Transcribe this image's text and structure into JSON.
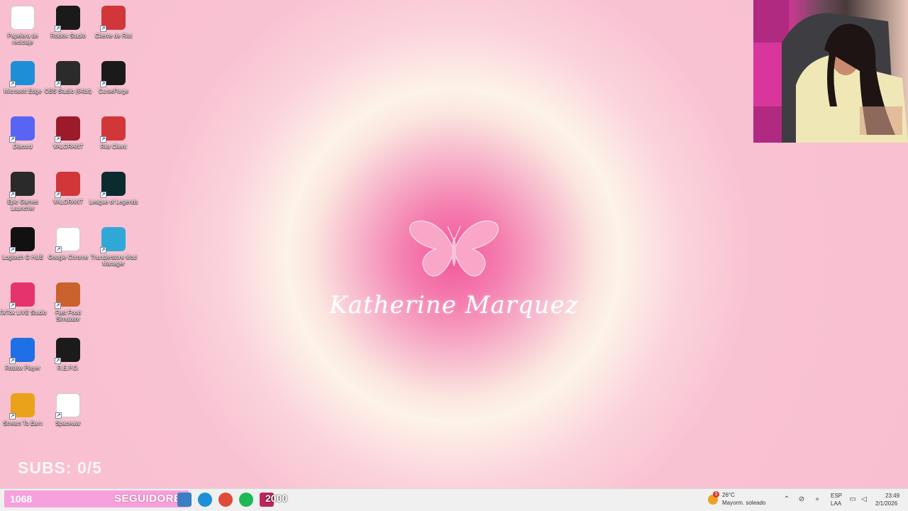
{
  "desktop": {
    "icons": [
      {
        "label": "Papelera de reciclaje",
        "icon": "recycle-bin-icon",
        "color": "#ffffff"
      },
      {
        "label": "Roblox Studio",
        "icon": "roblox-studio-icon",
        "color": "#1a1a1a"
      },
      {
        "label": "Cliente de Riot",
        "icon": "riot-client-icon",
        "color": "#d13639"
      },
      {
        "label": "Microsoft Edge",
        "icon": "edge-icon",
        "color": "#1e8fd6"
      },
      {
        "label": "OBS Studio (64bit)",
        "icon": "obs-icon",
        "color": "#2b2b2b"
      },
      {
        "label": "CurseForge",
        "icon": "curseforge-icon",
        "color": "#1a1a1a"
      },
      {
        "label": "Discord",
        "icon": "discord-icon",
        "color": "#5865f2"
      },
      {
        "label": "VALORANT",
        "icon": "valorant-icon",
        "color": "#9c1b2b"
      },
      {
        "label": "Riot Client",
        "icon": "riot-client-icon",
        "color": "#d13639"
      },
      {
        "label": "Epic Games Launcher",
        "icon": "epic-games-icon",
        "color": "#2a2a2a"
      },
      {
        "label": "VALORANT",
        "icon": "valorant-icon",
        "color": "#d13639"
      },
      {
        "label": "League of Legends",
        "icon": "league-of-legends-icon",
        "color": "#0b2c2e"
      },
      {
        "label": "Logitech G HUB",
        "icon": "logitech-ghub-icon",
        "color": "#111111"
      },
      {
        "label": "Google Chrome",
        "icon": "chrome-icon",
        "color": "#ffffff"
      },
      {
        "label": "Thunderstore Mod Manager",
        "icon": "thunderstore-icon",
        "color": "#2fa8d8"
      },
      {
        "label": "TikTok LIVE Studio",
        "icon": "tiktok-live-icon",
        "color": "#e5336d"
      },
      {
        "label": "Fast Food Simulator",
        "icon": "fast-food-simulator-icon",
        "color": "#c9622c"
      },
      {
        "label": "Roblox Player",
        "icon": "roblox-player-icon",
        "color": "#1f6fe6"
      },
      {
        "label": "R.E.P.O.",
        "icon": "repo-icon",
        "color": "#1b1b1b"
      },
      {
        "label": "Stream To Earn",
        "icon": "stream-to-earn-icon",
        "color": "#e9a21a"
      },
      {
        "label": "Spacewar",
        "icon": "document-icon",
        "color": "#ffffff"
      }
    ]
  },
  "wallpaper": {
    "name": "Katherine Marquez",
    "accent": "#f2579a"
  },
  "overlay": {
    "subs": "SUBS: 0/5",
    "followers_count": "1068",
    "followers_label": "SEGUIDORES",
    "followers_goal": "2000",
    "bar_color": "#f6a0dc"
  },
  "taskbar": {
    "apps": [
      {
        "icon": "file-explorer-icon",
        "color": "#3a7fc2"
      },
      {
        "icon": "edge-icon",
        "color": "#1e8fd6"
      },
      {
        "icon": "chrome-icon",
        "color": "#e04a3a"
      },
      {
        "icon": "spotify-icon",
        "color": "#1db954"
      },
      {
        "icon": "app-icon",
        "color": "#c0245a"
      }
    ],
    "weather_temp": "26°C",
    "weather_desc": "Mayorm. soleado",
    "weather_badge": "3",
    "lang_top": "ESP",
    "lang_bottom": "LAA",
    "time": "23:49",
    "date": "2/1/2026"
  }
}
